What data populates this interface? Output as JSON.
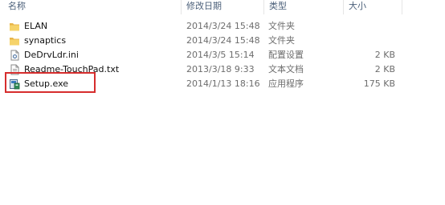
{
  "columns": {
    "name": "名称",
    "date": "修改日期",
    "type": "类型",
    "size": "大小"
  },
  "files": [
    {
      "name": "ELAN",
      "date": "2014/3/24 15:48",
      "type": "文件夹",
      "size": "",
      "icon": "folder-icon"
    },
    {
      "name": "synaptics",
      "date": "2014/3/24 15:48",
      "type": "文件夹",
      "size": "",
      "icon": "folder-icon"
    },
    {
      "name": "DeDrvLdr.ini",
      "date": "2014/3/5 15:14",
      "type": "配置设置",
      "size": "2 KB",
      "icon": "settings-file-icon"
    },
    {
      "name": "Readme-TouchPad.txt",
      "date": "2013/3/18 9:33",
      "type": "文本文档",
      "size": "2 KB",
      "icon": "text-file-icon"
    },
    {
      "name": "Setup.exe",
      "date": "2014/1/13 18:16",
      "type": "应用程序",
      "size": "175 KB",
      "icon": "setup-exe-icon"
    }
  ],
  "highlight": {
    "target": "Setup.exe",
    "color": "#d62d2d"
  }
}
